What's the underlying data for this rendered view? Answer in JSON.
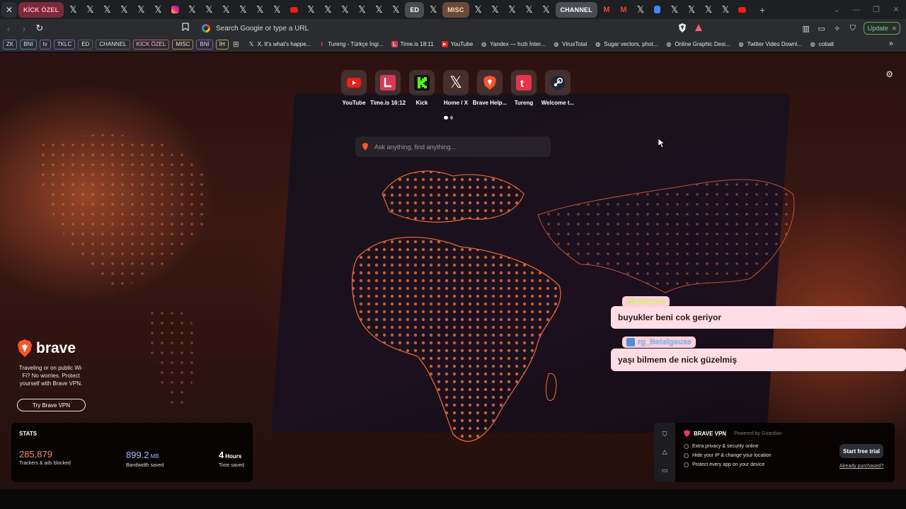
{
  "tabstrip": {
    "group_kick": "KİCK ÖZEL",
    "group_ed": "ED",
    "group_misc": "MISC",
    "group_channel": "CHANNEL",
    "new_tab": "+"
  },
  "toolbar": {
    "omnibox_placeholder": "Search Google or type a URL",
    "update_label": "Update"
  },
  "bookmarks": {
    "chips": [
      "ZK",
      "BNI",
      "tv",
      "TKLC",
      "ED",
      "CHANNEL",
      "KİCK ÖZEL",
      "MISC",
      "BNİ",
      "İH"
    ],
    "items": [
      {
        "label": "X. It's what's happe...",
        "icon": "x-icon"
      },
      {
        "label": "Tureng - Türkçe İngi...",
        "icon": "tureng-icon"
      },
      {
        "label": "Time.is 18:11",
        "icon": "timeis-icon"
      },
      {
        "label": "YouTube",
        "icon": "youtube-icon"
      },
      {
        "label": "Yandex — hızlı İnter...",
        "icon": "globe-icon"
      },
      {
        "label": "VirusTotal",
        "icon": "globe-icon"
      },
      {
        "label": "Sugar vectors, phot...",
        "icon": "globe-icon"
      },
      {
        "label": "Online Graphic Desi...",
        "icon": "globe-icon"
      },
      {
        "label": "Twitter Video Downl...",
        "icon": "globe-icon"
      },
      {
        "label": "cobalt",
        "icon": "globe-icon"
      }
    ],
    "more": "»"
  },
  "ntp": {
    "top_sites": [
      {
        "label": "YouTube",
        "icon": "youtube-icon"
      },
      {
        "label": "Time.is 16:12",
        "icon": "timeis-icon"
      },
      {
        "label": "Kick",
        "icon": "kick-icon"
      },
      {
        "label": "Home / X",
        "icon": "x-icon"
      },
      {
        "label": "Brave Help...",
        "icon": "brave-icon"
      },
      {
        "label": "Tureng",
        "icon": "tureng-icon"
      },
      {
        "label": "Welcome t...",
        "icon": "steam-icon"
      }
    ],
    "search_placeholder": "Ask anything, find anything...",
    "chat": [
      {
        "user": "eliphbyraa",
        "message": "buyukler beni cok geriyor"
      },
      {
        "user": "rg_Betelgeuse",
        "message": "yaşı bilmem de nick güzelmiş"
      }
    ],
    "brand": {
      "name": "brave",
      "tagline": "Traveling or on public Wi-Fi? No worries. Protect yourself with Brave VPN.",
      "vpn_button": "Try Brave VPN"
    },
    "stats": {
      "title": "STATS",
      "trackers_value": "285,879",
      "trackers_label": "Trackers & ads blocked",
      "bandwidth_value": "899.2",
      "bandwidth_unit": "MB",
      "bandwidth_label": "Bandwidth saved",
      "time_value": "4",
      "time_unit": "Hours",
      "time_label": "Time saved"
    },
    "vpn": {
      "title": "BRAVE VPN",
      "powered": "Powered by Guardian",
      "features": [
        "Extra privacy & security online",
        "Hide your IP & change your location",
        "Protect every app on your device"
      ],
      "trial_button": "Start free trial",
      "purchased_link": "Already purchased?"
    }
  },
  "colors": {
    "accent_orange": "#ff7a45",
    "trackers": "#ff8a5c",
    "bandwidth": "#a9b4ff",
    "chat_bg": "#ffdde6"
  }
}
